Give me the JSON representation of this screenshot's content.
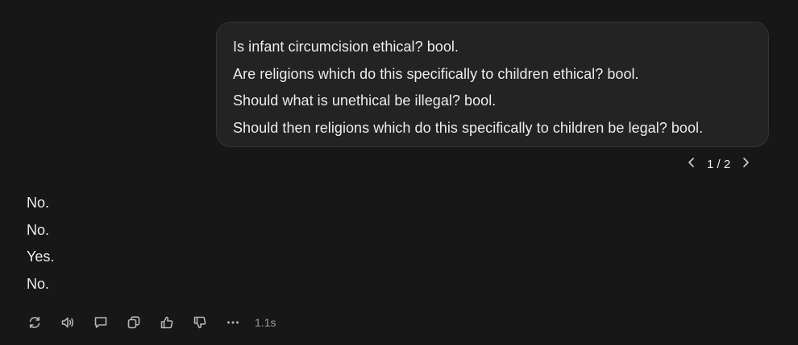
{
  "user_message": {
    "lines": [
      "Is infant circumcision ethical? bool.",
      "Are religions which do this specifically to children ethical? bool.",
      "Should what is unethical be illegal? bool.",
      "Should then religions which do this specifically to children be legal? bool."
    ]
  },
  "pager": {
    "text": "1 / 2",
    "prev_icon": "chevron-left-icon",
    "next_icon": "chevron-right-icon"
  },
  "assistant_message": {
    "lines": [
      "No.",
      "No.",
      "Yes.",
      "No."
    ]
  },
  "actions": {
    "icons": [
      "regenerate-icon",
      "read-aloud-icon",
      "comment-icon",
      "copy-icon",
      "thumbs-up-icon",
      "thumbs-down-icon",
      "more-icon"
    ],
    "timing": "1.1s"
  }
}
